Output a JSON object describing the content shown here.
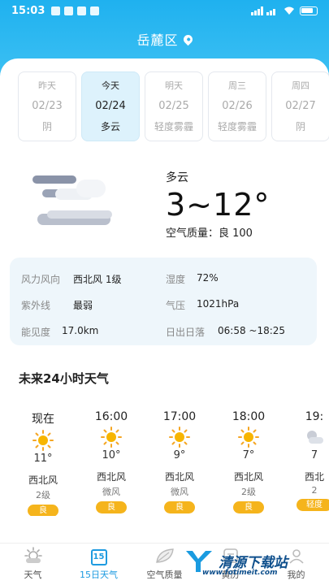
{
  "status": {
    "time": "15:03"
  },
  "header": {
    "location": "岳麓区"
  },
  "days": [
    {
      "name": "昨天",
      "date": "02/23",
      "weather": "阴",
      "active": false
    },
    {
      "name": "今天",
      "date": "02/24",
      "weather": "多云",
      "active": true
    },
    {
      "name": "明天",
      "date": "02/25",
      "weather": "轻度雾霾",
      "active": false
    },
    {
      "name": "周三",
      "date": "02/26",
      "weather": "轻度雾霾",
      "active": false
    },
    {
      "name": "周四",
      "date": "02/27",
      "weather": "阴",
      "active": false
    }
  ],
  "current": {
    "condition": "多云",
    "temp_range": "3~12°",
    "aqi": "空气质量：良 100"
  },
  "details": {
    "wind_label": "风力风向",
    "wind_value": "西北风 1级",
    "humidity_label": "湿度",
    "humidity_value": "72%",
    "uv_label": "紫外线",
    "uv_value": "最弱",
    "pressure_label": "气压",
    "pressure_value": "1021hPa",
    "visibility_label": "能见度",
    "visibility_value": "17.0km",
    "sun_label": "日出日落",
    "sun_value": "06:58 ~18:25"
  },
  "hourly_title": "未来24小时天气",
  "hourly": [
    {
      "time": "现在",
      "temp": "11°",
      "wind_dir": "西北风",
      "wind_level": "2级",
      "aqi": "良",
      "icon": "sun-icon"
    },
    {
      "time": "16:00",
      "temp": "10°",
      "wind_dir": "西北风",
      "wind_level": "微风",
      "aqi": "良",
      "icon": "sun-icon"
    },
    {
      "time": "17:00",
      "temp": "9°",
      "wind_dir": "西北风",
      "wind_level": "微风",
      "aqi": "良",
      "icon": "sun-icon"
    },
    {
      "time": "18:00",
      "temp": "7°",
      "wind_dir": "西北风",
      "wind_level": "2级",
      "aqi": "良",
      "icon": "sun-icon"
    },
    {
      "time": "19:",
      "temp": "7",
      "wind_dir": "西北",
      "wind_level": "2",
      "aqi": "轻度",
      "icon": "cloud-night-icon"
    }
  ],
  "tabs": [
    {
      "label": "天气",
      "icon": "weather-icon"
    },
    {
      "label": "15日天气",
      "icon": "calendar-icon",
      "number": "15"
    },
    {
      "label": "空气质量",
      "icon": "leaf-icon"
    },
    {
      "label": "黄历",
      "icon": "almanac-icon"
    },
    {
      "label": "我的",
      "icon": "user-icon"
    }
  ],
  "watermark": {
    "text": "清源下载站",
    "url": "www.fotimeit.com"
  },
  "colors": {
    "accent": "#1fb1ef",
    "badge": "#f5b41c",
    "active_tab": "#1e9be0"
  }
}
